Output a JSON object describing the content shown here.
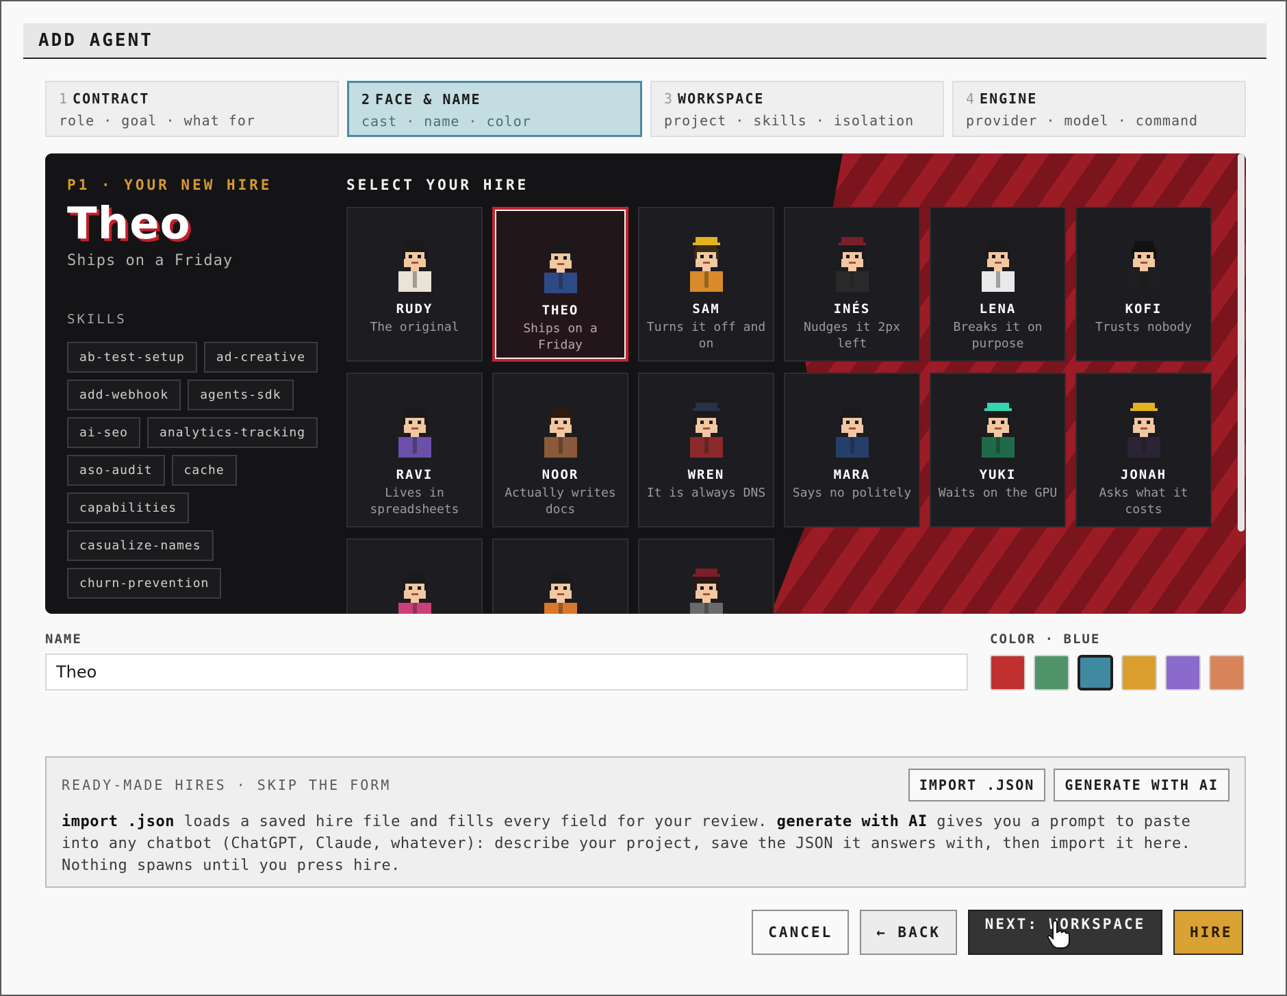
{
  "window": {
    "title": "ADD AGENT"
  },
  "steps": [
    {
      "num": "1",
      "title": "CONTRACT",
      "sub": "role · goal · what for"
    },
    {
      "num": "2",
      "title": "FACE & NAME",
      "sub": "cast · name · color"
    },
    {
      "num": "3",
      "title": "WORKSPACE",
      "sub": "project · skills · isolation"
    },
    {
      "num": "4",
      "title": "ENGINE",
      "sub": "provider · model · command"
    }
  ],
  "hero": {
    "tag": "P1 · YOUR NEW HIRE",
    "name": "Theo",
    "tagline": "Ships on a Friday",
    "skills_heading": "SKILLS",
    "skills": [
      "ab-test-setup",
      "ad-creative",
      "add-webhook",
      "agents-sdk",
      "ai-seo",
      "analytics-tracking",
      "aso-audit",
      "cache",
      "capabilities",
      "casualize-names",
      "churn-prevention"
    ]
  },
  "cast": {
    "heading": "SELECT YOUR HIRE",
    "selected": "THEO",
    "cards": [
      {
        "name": "RUDY",
        "desc": "The original",
        "skin": "#f1c8a2",
        "hair": "#1a1a1a",
        "shirt": "#e9e3d8",
        "hat": ""
      },
      {
        "name": "THEO",
        "desc": "Ships on a Friday",
        "skin": "#f1c8a2",
        "hair": "#1a1a1a",
        "shirt": "#2d4a86",
        "hat": ""
      },
      {
        "name": "SAM",
        "desc": "Turns it off and on",
        "skin": "#f1c8a2",
        "hair": "#3a2a1a",
        "shirt": "#d98a2a",
        "hat": "#e3b21f"
      },
      {
        "name": "INÉS",
        "desc": "Nudges it 2px left",
        "skin": "#f1c8a2",
        "hair": "#1a1a1a",
        "shirt": "#2a2a2a",
        "hat": "#7a1f2a"
      },
      {
        "name": "LENA",
        "desc": "Breaks it on purpose",
        "skin": "#f1c8a2",
        "hair": "#1a1a1a",
        "shirt": "#e9e9e9",
        "hat": ""
      },
      {
        "name": "KOFI",
        "desc": "Trusts nobody",
        "skin": "#f1c8a2",
        "hair": "#111111",
        "shirt": "#1e1e1e",
        "hat": ""
      },
      {
        "name": "RAVI",
        "desc": "Lives in spreadsheets",
        "skin": "#f1c8a2",
        "hair": "#1a1a1a",
        "shirt": "#6b4fa8",
        "hat": ""
      },
      {
        "name": "NOOR",
        "desc": "Actually writes docs",
        "skin": "#f1c8a2",
        "hair": "#2a1a12",
        "shirt": "#8a5a3a",
        "hat": ""
      },
      {
        "name": "WREN",
        "desc": "It is always DNS",
        "skin": "#f1c8a2",
        "hair": "#1a1a1a",
        "shirt": "#8a2a2a",
        "hat": "#24324a"
      },
      {
        "name": "MARA",
        "desc": "Says no politely",
        "skin": "#f1c8a2",
        "hair": "#1a1a1a",
        "shirt": "#24406a",
        "hat": ""
      },
      {
        "name": "YUKI",
        "desc": "Waits on the GPU",
        "skin": "#f1c8a2",
        "hair": "#1a1a1a",
        "shirt": "#1f6a4a",
        "hat": "#36d3b0"
      },
      {
        "name": "JONAH",
        "desc": "Asks what it costs",
        "skin": "#f1c8a2",
        "hair": "#1a1a1a",
        "shirt": "#2a2434",
        "hat": "#e3b21f"
      },
      {
        "name": "",
        "desc": "",
        "skin": "#f1c8a2",
        "hair": "#1a1a1a",
        "shirt": "#c9407a",
        "hat": ""
      },
      {
        "name": "",
        "desc": "",
        "skin": "#f1c8a2",
        "hair": "#1a1a1a",
        "shirt": "#d9772a",
        "hat": ""
      },
      {
        "name": "",
        "desc": "",
        "skin": "#f1c8a2",
        "hair": "#2a1a12",
        "shirt": "#6a6a6a",
        "hat": "#7a1f2a"
      }
    ]
  },
  "name_field": {
    "label": "NAME",
    "value": "Theo"
  },
  "color": {
    "label": "COLOR · BLUE",
    "selected": "#3f8aa0",
    "swatches": [
      "#c0302f",
      "#4f9468",
      "#3f8aa0",
      "#d99e2e",
      "#8a6acc",
      "#d8845a"
    ]
  },
  "ready": {
    "heading": "READY-MADE HIRES · SKIP THE FORM",
    "import_label": "IMPORT .JSON",
    "generate_label": "GENERATE WITH AI",
    "body_b1": "import .json",
    "body_t1": " loads a saved hire file and fills every field for your review. ",
    "body_b2": "generate with AI",
    "body_t2": " gives you a prompt to paste into any chatbot (ChatGPT, Claude, whatever): describe your project, save the JSON it answers with, then import it here. Nothing spawns until you press hire."
  },
  "actions": {
    "cancel": "CANCEL",
    "back": "← BACK",
    "next": "NEXT: WORKSPACE →",
    "hire": "HIRE"
  },
  "colors": {
    "accent": "#d69a2c",
    "selected_border": "#c7222f",
    "stripe": "#9c1c26",
    "stripe_dark": "#7a141d"
  }
}
